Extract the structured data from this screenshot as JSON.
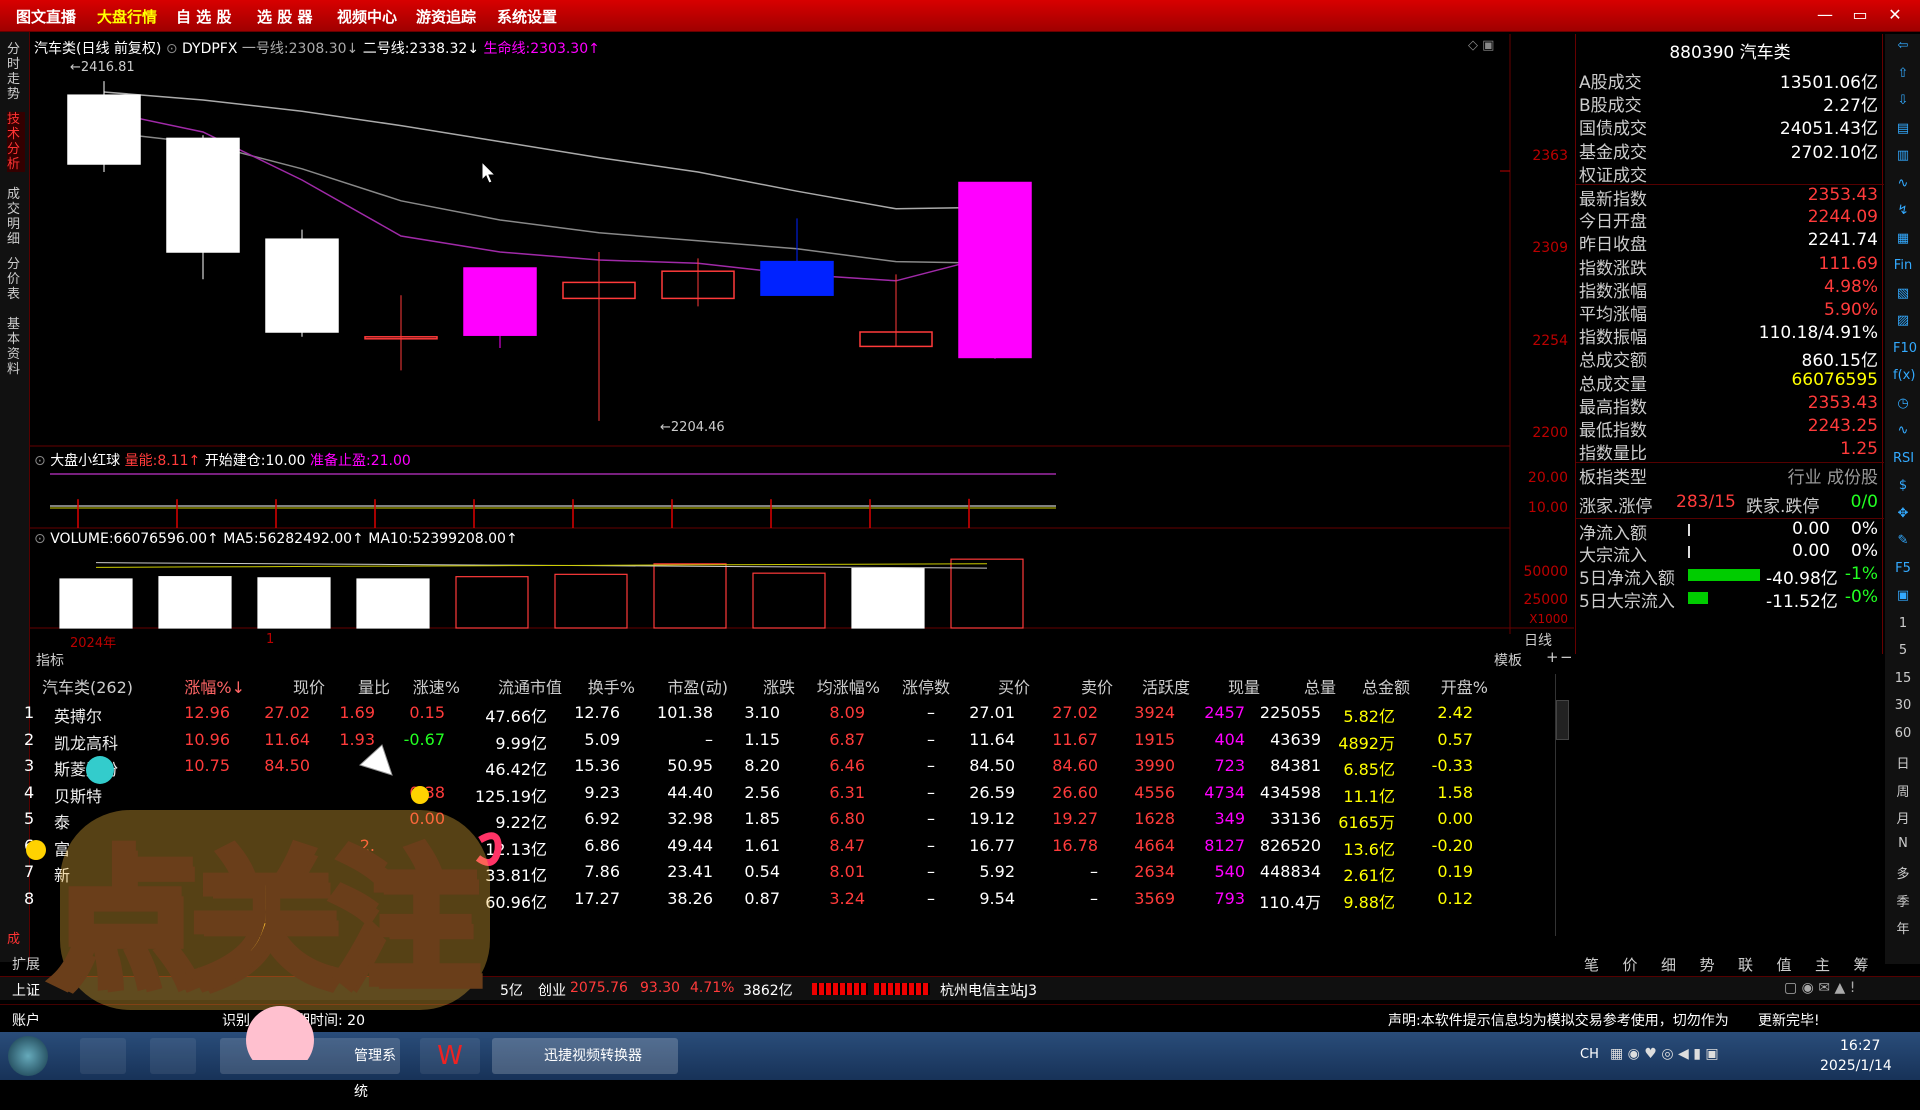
{
  "menu": [
    "图文直播",
    "大盘行情",
    "自 选 股",
    "选 股 器",
    "视频中心",
    "游资追踪",
    "系统设置"
  ],
  "window_buttons": [
    "—",
    "▭",
    "✕"
  ],
  "left_tabs": [
    "分时走势",
    "技术分析",
    "成交明细",
    "分价表",
    "基本资料"
  ],
  "chart_header": {
    "title": "汽车类(日线 前复权)",
    "indicator": "DYDPFX",
    "line1_label": "一号线:",
    "line1_value": "2308.30↓",
    "line2_label": "二号线:",
    "line2_value": "2338.32↓",
    "life_label": "生命线:",
    "life_value": "2303.30↑",
    "high_mark": "2416.81",
    "low_mark": "2204.46"
  },
  "price_axis": [
    "2363",
    "2309",
    "2254",
    "2200"
  ],
  "sub1": {
    "name": "大盘小红球",
    "f1_label": "量能:",
    "f1_value": "8.11↑",
    "f2_label": "开始建仓:",
    "f2_value": "10.00",
    "f3_label": "准备止盈:",
    "f3_value": "21.00",
    "axis": [
      "20.00",
      "10.00"
    ]
  },
  "vol": {
    "label": "VOLUME:",
    "value": "66076596.00↑",
    "ma5_label": "MA5:",
    "ma5_value": "56282492.00↑",
    "ma10_label": "MA10:",
    "ma10_value": "52399208.00↑",
    "axis": [
      "50000",
      "25000"
    ],
    "unit": "X1000"
  },
  "date_axis": [
    "2024年",
    "1"
  ],
  "period": "日线",
  "indicator_tab": "指标",
  "template_tab": "模板",
  "right_panel": {
    "title_code": "880390",
    "title_name": "汽车类",
    "rows": [
      {
        "k": "A股成交",
        "v": "13501.06亿",
        "c": "white"
      },
      {
        "k": "B股成交",
        "v": "2.27亿",
        "c": "white"
      },
      {
        "k": "国债成交",
        "v": "24051.43亿",
        "c": "white"
      },
      {
        "k": "基金成交",
        "v": "2702.10亿",
        "c": "white"
      },
      {
        "k": "权证成交",
        "v": "",
        "c": "white"
      },
      {
        "k": "最新指数",
        "v": "2353.43",
        "c": "red"
      },
      {
        "k": "今日开盘",
        "v": "2244.09",
        "c": "red"
      },
      {
        "k": "昨日收盘",
        "v": "2241.74",
        "c": "white"
      },
      {
        "k": "指数涨跌",
        "v": "111.69",
        "c": "red"
      },
      {
        "k": "指数涨幅",
        "v": "4.98%",
        "c": "red"
      },
      {
        "k": "平均涨幅",
        "v": "5.90%",
        "c": "red"
      },
      {
        "k": "指数振幅",
        "v": "110.18/4.91%",
        "c": "white"
      },
      {
        "k": "总成交额",
        "v": "860.15亿",
        "c": "white"
      },
      {
        "k": "总成交量",
        "v": "66076595",
        "c": "yellow"
      },
      {
        "k": "最高指数",
        "v": "2353.43",
        "c": "red"
      },
      {
        "k": "最低指数",
        "v": "2243.25",
        "c": "red"
      },
      {
        "k": "指数量比",
        "v": "1.25",
        "c": "red"
      },
      {
        "k": "板指类型",
        "v": "行业 成份股",
        "c": "gray"
      }
    ],
    "updown": {
      "k1": "涨家.涨停",
      "v1": "283/15",
      "k2": "跌家.跌停",
      "v2": "0/0"
    },
    "flows": [
      {
        "k": "净流入额",
        "v": "0.00",
        "p": "0%",
        "bar": 0
      },
      {
        "k": "大宗流入",
        "v": "0.00",
        "p": "0%",
        "bar": 0
      },
      {
        "k": "5日净流入额",
        "v": "-40.98亿",
        "p": "-1%",
        "bar": 1.0
      },
      {
        "k": "5日大宗流入",
        "v": "-11.52亿",
        "p": "-0%",
        "bar": 0.28
      }
    ]
  },
  "right_icons": [
    "⇦",
    "⇧",
    "⇩",
    "▤",
    "▥",
    "∿",
    "↯",
    "▦",
    "Fin",
    "▧",
    "▨",
    "F10",
    "f(x)",
    "◷",
    "∿",
    "RSI",
    "$",
    "✥",
    "✎",
    "F5",
    "▣",
    "1",
    "5",
    "15",
    "30",
    "60",
    "日",
    "周",
    "月",
    "N",
    "多",
    "季",
    "年"
  ],
  "table": {
    "headers": [
      "汽车类(262)",
      "涨幅%↓",
      "现价",
      "量比",
      "涨速%",
      "流通市值",
      "换手%",
      "市盈(动)",
      "涨跌",
      "均涨幅%",
      "涨停数",
      "买价",
      "卖价",
      "活跃度",
      "现量",
      "总量",
      "总金额",
      "开盘%"
    ],
    "rows": [
      {
        "no": "1",
        "name": "英搏尔",
        "cells": [
          "12.96",
          "27.02",
          "1.69",
          "0.15",
          "47.66亿",
          "12.76",
          "101.38",
          "3.10",
          "8.09",
          "–",
          "27.01",
          "27.02",
          "3924",
          "2457",
          "225055",
          "5.82亿",
          "2.42"
        ]
      },
      {
        "no": "2",
        "name": "凯龙高科",
        "cells": [
          "10.96",
          "11.64",
          "1.93",
          "-0.67",
          "9.99亿",
          "5.09",
          "–",
          "1.15",
          "6.87",
          "–",
          "11.64",
          "11.67",
          "1915",
          "404",
          "43639",
          "4892万",
          "0.57"
        ]
      },
      {
        "no": "3",
        "name": "斯菱股份",
        "cells": [
          "10.75",
          "84.50",
          "",
          "",
          "46.42亿",
          "15.36",
          "50.95",
          "8.20",
          "6.46",
          "–",
          "84.50",
          "84.60",
          "3990",
          "723",
          "84381",
          "6.85亿",
          "-0.33"
        ]
      },
      {
        "no": "4",
        "name": "贝斯特",
        "cells": [
          "",
          "",
          "",
          "0.38",
          "125.19亿",
          "9.23",
          "44.40",
          "2.56",
          "6.31",
          "–",
          "26.59",
          "26.60",
          "4556",
          "4734",
          "434598",
          "11.1亿",
          "1.58"
        ]
      },
      {
        "no": "5",
        "name": "泰",
        "cells": [
          "",
          "",
          "",
          "0.00",
          "9.22亿",
          "6.92",
          "32.98",
          "1.85",
          "6.80",
          "–",
          "19.12",
          "19.27",
          "1628",
          "349",
          "33136",
          "6165万",
          "0.00"
        ]
      },
      {
        "no": "6",
        "name": "富",
        "cells": [
          "",
          "",
          "2.",
          "",
          "12.13亿",
          "6.86",
          "49.44",
          "1.61",
          "8.47",
          "–",
          "16.77",
          "16.78",
          "4664",
          "8127",
          "826520",
          "13.6亿",
          "-0.20"
        ]
      },
      {
        "no": "7",
        "name": "新",
        "cells": [
          "",
          "",
          "",
          "",
          "33.81亿",
          "7.86",
          "23.41",
          "0.54",
          "8.01",
          "–",
          "5.92",
          "–",
          "2634",
          "540",
          "448834",
          "2.61亿",
          "0.19"
        ]
      },
      {
        "no": "8",
        "name": "",
        "cells": [
          "",
          "",
          "",
          "",
          "60.96亿",
          "17.27",
          "38.26",
          "0.87",
          "3.24",
          "–",
          "9.54",
          "–",
          "3569",
          "793",
          "110.4万",
          "9.88亿",
          "0.12"
        ]
      }
    ]
  },
  "bottom_tabs": [
    "笔",
    "价",
    "细",
    "势",
    "联",
    "值",
    "主",
    "筹"
  ],
  "left_bottom_tabs": [
    "成",
    "扩展"
  ],
  "status": {
    "sh_label": "上证",
    "sh_part": "5亿",
    "cy_label": "创业",
    "cy_value": "2075.76",
    "cy_change": "93.30",
    "cy_pct": "4.71%",
    "cy_amount": "3862亿",
    "server": "杭州电信主站J3"
  },
  "info": {
    "left": "账户",
    "mid1": "识别",
    "mid2": "服期时间: 20",
    "disclaimer": "声明:本软件提示信息均为模拟交易参考使用，切勿作为",
    "update": "更新完毕!"
  },
  "taskbar": {
    "item1": "管理系统",
    "item2": "迅捷视频转换器",
    "lang": "CH",
    "time": "16:27",
    "date": "2025/1/14"
  },
  "overlay_text": "点关注",
  "chart_data": {
    "type": "candlestick",
    "candles": [
      {
        "o": 2365,
        "c": 2408,
        "h": 2416.81,
        "l": 2360
      },
      {
        "o": 2310,
        "c": 2381,
        "h": 2383,
        "l": 2293
      },
      {
        "o": 2260,
        "c": 2318,
        "h": 2324,
        "l": 2257
      },
      {
        "o": 2257,
        "c": 2257,
        "h": 2283,
        "l": 2236
      },
      {
        "o": 2258,
        "c": 2300,
        "h": 2300,
        "l": 2250
      },
      {
        "o": 2281,
        "c": 2291,
        "h": 2310,
        "l": 2204.46
      },
      {
        "o": 2281,
        "c": 2298,
        "h": 2306,
        "l": 2276
      },
      {
        "o": 2283,
        "c": 2304,
        "h": 2331,
        "l": 2304
      },
      {
        "o": 2251,
        "c": 2260,
        "h": 2296,
        "l": 2251
      },
      {
        "o": 2244.09,
        "c": 2353.43,
        "h": 2353.43,
        "l": 2243.25
      }
    ],
    "colors": [
      "white",
      "white",
      "white",
      "red",
      "magenta",
      "red",
      "red",
      "blue",
      "red",
      "magenta"
    ],
    "line1": [
      2410,
      2405,
      2398,
      2389,
      2379,
      2369,
      2360,
      2348,
      2337,
      2338
    ],
    "line2": [
      2385,
      2378,
      2362,
      2342,
      2330,
      2322,
      2317,
      2312,
      2304,
      2303
    ],
    "purple": [
      2398,
      2385,
      2355,
      2320,
      2310,
      2305,
      2303,
      2296,
      2292,
      2308
    ],
    "ylim": [
      2195,
      2425
    ],
    "volumes": [
      42000,
      44000,
      43000,
      42000,
      44000,
      46000,
      55000,
      47000,
      51000,
      59000
    ],
    "volume_colors": [
      "white",
      "white",
      "white",
      "white",
      "red",
      "red",
      "red",
      "red",
      "white",
      "red"
    ],
    "sub_spikes": [
      8,
      8,
      8,
      8,
      8,
      8,
      8,
      8,
      8,
      8.11
    ]
  }
}
